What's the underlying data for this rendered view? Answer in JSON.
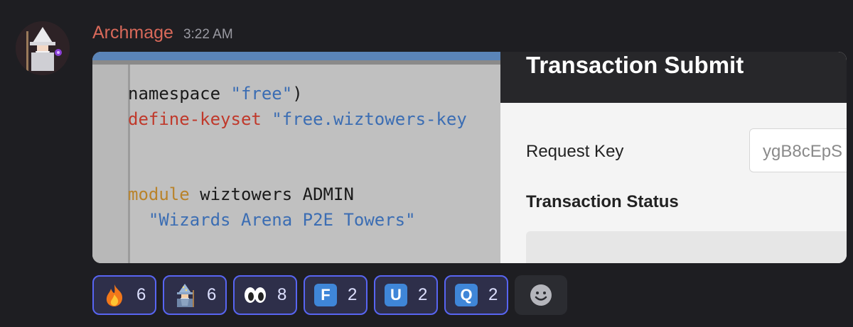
{
  "message": {
    "username": "Archmage",
    "timestamp": "3:22 AM",
    "username_color": "#d9695a"
  },
  "attachment": {
    "code_lines": [
      {
        "parts": [
          {
            "t": "namespace ",
            "c": "plain"
          },
          {
            "t": "\"free\"",
            "c": "str"
          },
          {
            "t": ")",
            "c": "plain"
          }
        ]
      },
      {
        "parts": [
          {
            "t": "define-keyset ",
            "c": "red"
          },
          {
            "t": "\"free.wiztowers-key",
            "c": "str"
          }
        ]
      },
      {
        "parts": []
      },
      {
        "parts": []
      },
      {
        "parts": [
          {
            "t": "module ",
            "c": "orange"
          },
          {
            "t": "wiztowers ADMIN",
            "c": "plain"
          }
        ]
      },
      {
        "parts": [
          {
            "t": "  \"Wizards Arena P2E Towers\"",
            "c": "str"
          }
        ]
      }
    ],
    "tx_title": "Transaction Submit",
    "request_key_label": "Request Key",
    "request_key_value": "ygB8cEpS",
    "transaction_status_label": "Transaction Status"
  },
  "reactions": [
    {
      "emoji": "fire-icon",
      "count": "6"
    },
    {
      "emoji": "wizard-icon",
      "count": "6"
    },
    {
      "emoji": "eyes-icon",
      "count": "8"
    },
    {
      "emoji": "letter",
      "letter": "F",
      "count": "2"
    },
    {
      "emoji": "letter",
      "letter": "U",
      "count": "2"
    },
    {
      "emoji": "letter",
      "letter": "Q",
      "count": "2"
    }
  ],
  "add_reaction_icon": "add-reaction-icon",
  "colors": {
    "background": "#1e1e22",
    "reaction_bg": "#2e2f4a",
    "reaction_border": "#5865f2",
    "letter_tile": "#3f86d8"
  }
}
